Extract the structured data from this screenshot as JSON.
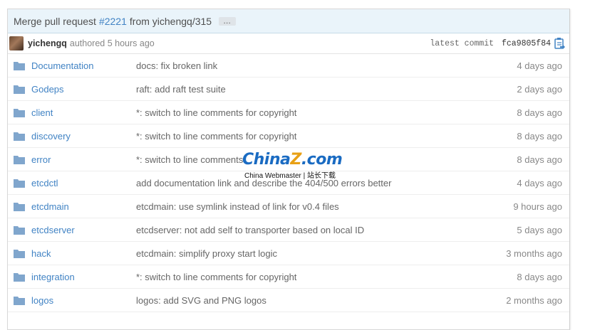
{
  "commit": {
    "title_prefix": "Merge pull request",
    "pr_number": "#2221",
    "title_suffix": "from yichengq/315",
    "ellipsis_label": "…",
    "author": "yichengq",
    "authored_text": "authored 5 hours ago",
    "latest_label": "latest commit",
    "sha": "fca9805f84"
  },
  "files": [
    {
      "name": "Documentation",
      "message": "docs: fix broken link",
      "age": "4 days ago"
    },
    {
      "name": "Godeps",
      "message": "raft: add raft test suite",
      "age": "2 days ago"
    },
    {
      "name": "client",
      "message": "*: switch to line comments for copyright",
      "age": "8 days ago"
    },
    {
      "name": "discovery",
      "message": "*: switch to line comments for copyright",
      "age": "8 days ago"
    },
    {
      "name": "error",
      "message": "*: switch to line comments",
      "age": "8 days ago"
    },
    {
      "name": "etcdctl",
      "message": "add documentation link and describe the 404/500 errors better",
      "age": "4 days ago"
    },
    {
      "name": "etcdmain",
      "message": "etcdmain: use symlink instead of link for v0.4 files",
      "age": "9 hours ago"
    },
    {
      "name": "etcdserver",
      "message": "etcdserver: not add self to transporter based on local ID",
      "age": "5 days ago"
    },
    {
      "name": "hack",
      "message": "etcdmain: simplify proxy start logic",
      "age": "3 months ago"
    },
    {
      "name": "integration",
      "message": "*: switch to line comments for copyright",
      "age": "8 days ago"
    },
    {
      "name": "logos",
      "message": "logos: add SVG and PNG logos",
      "age": "2 months ago"
    }
  ],
  "watermark": {
    "logo_china": "China",
    "logo_z": "Z",
    "logo_com": ".com",
    "subtitle": "China Webmaster | 站长下载"
  },
  "colors": {
    "link": "#4183c4",
    "folder": "#80a6cd",
    "header_bg": "#eaf4fa"
  },
  "icons": [
    "folder-icon",
    "clipboard-icon",
    "avatar"
  ]
}
